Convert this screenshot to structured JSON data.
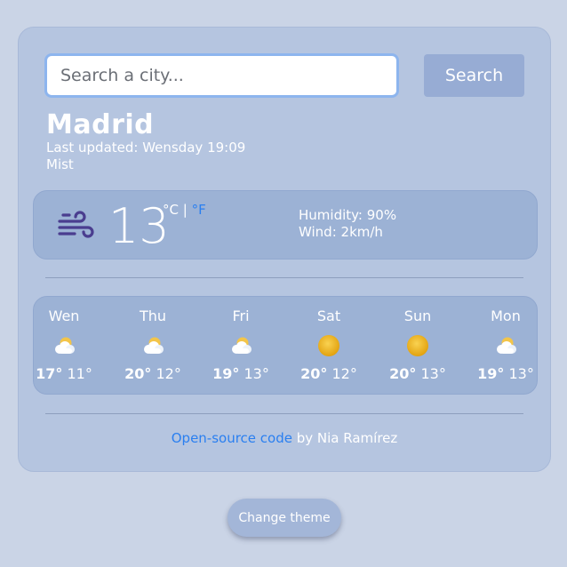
{
  "search": {
    "placeholder": "Search a city...",
    "button_label": "Search"
  },
  "location": {
    "city": "Madrid",
    "last_updated": "Last updated: Wensday 19:09",
    "description": "Mist"
  },
  "current": {
    "icon": "wind-icon",
    "temperature": "13",
    "unit_celsius": "°C",
    "unit_separator": "|",
    "unit_fahrenheit": "°F",
    "humidity": "Humidity: 90%",
    "wind": "Wind: 2km/h"
  },
  "forecast": [
    {
      "day": "Wen",
      "icon": "partly-cloudy-icon",
      "max": "17°",
      "min": "11°"
    },
    {
      "day": "Thu",
      "icon": "partly-cloudy-icon",
      "max": "20°",
      "min": "12°"
    },
    {
      "day": "Fri",
      "icon": "partly-cloudy-icon",
      "max": "19°",
      "min": "13°"
    },
    {
      "day": "Sat",
      "icon": "sun-icon",
      "max": "20°",
      "min": "12°"
    },
    {
      "day": "Sun",
      "icon": "sun-icon",
      "max": "20°",
      "min": "13°"
    },
    {
      "day": "Mon",
      "icon": "partly-cloudy-icon",
      "max": "19°",
      "min": "13°"
    }
  ],
  "footer": {
    "link_text": "Open-source code",
    "author_text": " by Nia Ramírez"
  },
  "theme_button_label": "Change theme",
  "colors": {
    "background": "#cad4e6",
    "card": "#b5c5e0",
    "panel": "#9cb2d5",
    "link": "#2a7ff0",
    "search_button": "#97acd4"
  }
}
